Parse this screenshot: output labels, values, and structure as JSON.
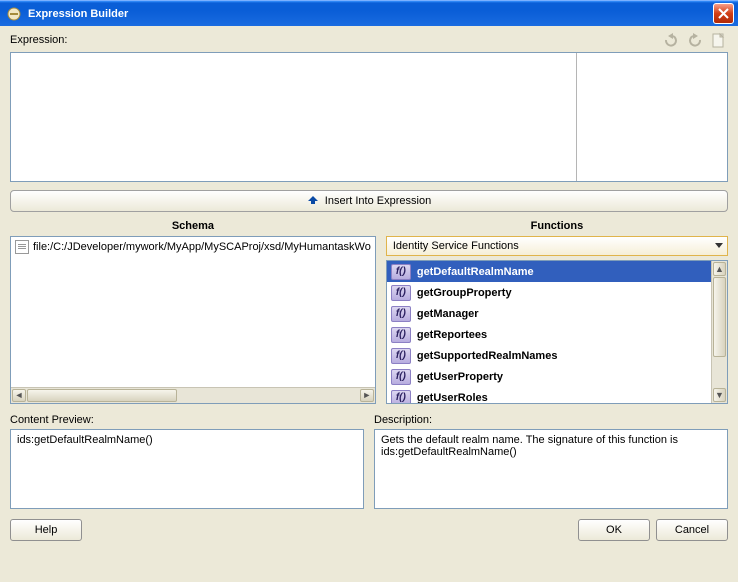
{
  "window": {
    "title": "Expression Builder"
  },
  "labels": {
    "expression": "Expression:",
    "insert": "Insert Into Expression",
    "schema": "Schema",
    "functions": "Functions",
    "contentPreview": "Content Preview:",
    "description": "Description:"
  },
  "schema": {
    "items": [
      {
        "path": "file:/C:/JDeveloper/mywork/MyApp/MySCAProj/xsd/MyHumantaskWo"
      }
    ]
  },
  "functions": {
    "category": "Identity Service Functions",
    "list": [
      {
        "name": "getDefaultRealmName",
        "selected": true
      },
      {
        "name": "getGroupProperty"
      },
      {
        "name": "getManager"
      },
      {
        "name": "getReportees"
      },
      {
        "name": "getSupportedRealmNames"
      },
      {
        "name": "getUserProperty"
      },
      {
        "name": "getUserRoles"
      }
    ]
  },
  "contentPreview": "ids:getDefaultRealmName()",
  "description": "Gets the default realm name. The signature of this function is ids:getDefaultRealmName()",
  "buttons": {
    "help": "Help",
    "ok": "OK",
    "cancel": "Cancel"
  }
}
